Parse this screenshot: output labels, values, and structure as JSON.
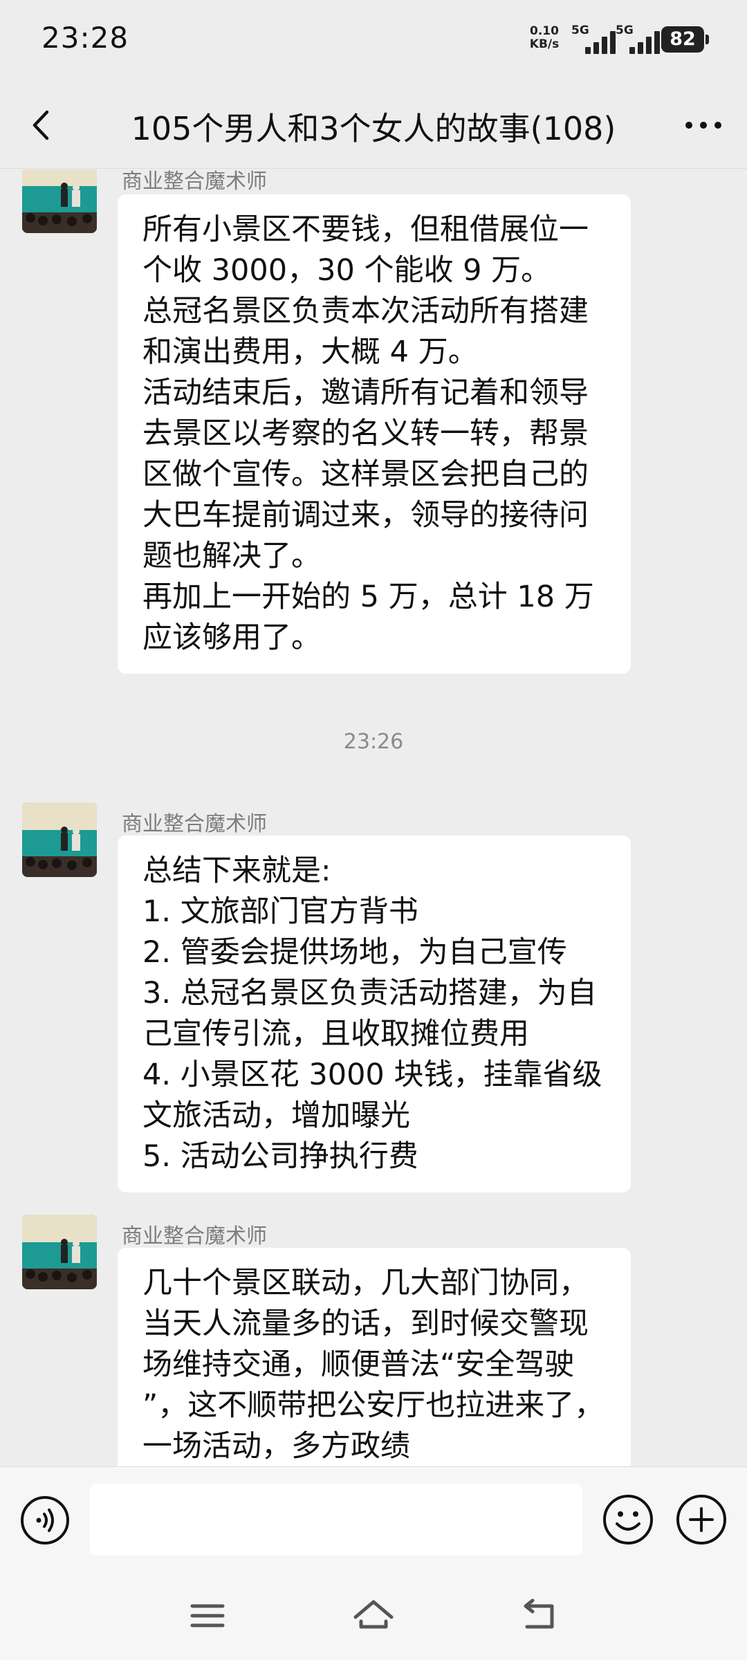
{
  "status_bar": {
    "time": "23:28",
    "net_speed_value": "0.10",
    "net_speed_unit": "KB/s",
    "signal1_label": "5G",
    "signal2_label": "5G",
    "battery": "82"
  },
  "header": {
    "title": "105个男人和3个女人的故事(108)"
  },
  "messages": [
    {
      "sender": "商业整合魔术师",
      "lines": [
        "所有小景区不要钱，但租借展位一",
        "个收 3000，30 个能收 9 万。",
        "总冠名景区负责本次活动所有搭建",
        "和演出费用，大概 4 万。",
        "活动结束后，邀请所有记着和领导",
        "去景区以考察的名义转一转，帮景",
        "区做个宣传。这样景区会把自己的",
        "大巴车提前调过来，领导的接待问",
        "题也解决了。",
        "再加上一开始的 5 万，总计 18 万",
        "应该够用了。"
      ]
    },
    {
      "sender": "商业整合魔术师",
      "lines": [
        "总结下来就是:",
        "1. 文旅部门官方背书",
        "2. 管委会提供场地，为自己宣传",
        "3. 总冠名景区负责活动搭建，为自",
        "己宣传引流，且收取摊位费用",
        "4. 小景区花 3000 块钱，挂靠省级",
        "文旅活动，增加曝光",
        "5. 活动公司挣执行费"
      ]
    },
    {
      "sender": "商业整合魔术师",
      "lines": [
        "几十个景区联动，几大部门协同，",
        "当天人流量多的话，到时候交警现",
        "场维持交通，顺便普法“安全驾驶",
        "”，这不顺带把公安厅也拉进来了，",
        "一场活动，多方政绩"
      ]
    }
  ],
  "timestamp": "23:26",
  "input": {
    "value": ""
  },
  "colors": {
    "background": "#ededed",
    "bubble": "#ffffff",
    "sender": "#7d7d7d",
    "avatar_teal": "#1f8f8a"
  },
  "icons": {
    "back": "chevron-left-icon",
    "more": "more-dots-icon",
    "voice": "voice-icon",
    "emoji": "emoji-icon",
    "plus": "plus-icon",
    "menu": "menu-icon",
    "home": "home-icon",
    "back_nav": "back-arrow-icon"
  }
}
